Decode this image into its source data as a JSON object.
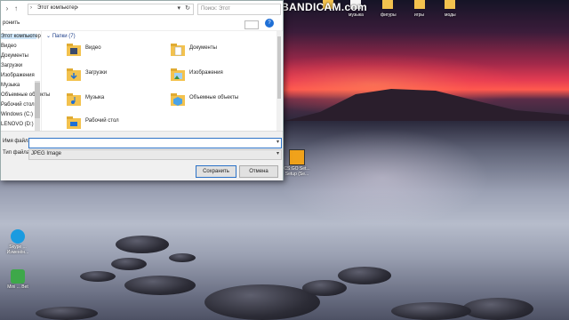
{
  "window": {
    "address_path": "Этот компьютер",
    "search_placeholder": "Поиск: Этот",
    "toolbar_left": "ронить",
    "help_symbol": "?"
  },
  "sidebar": {
    "items": [
      {
        "label": "Этот компьютер"
      },
      {
        "label": "Видео"
      },
      {
        "label": "Документы"
      },
      {
        "label": "Загрузки"
      },
      {
        "label": "Изображения"
      },
      {
        "label": "Музыка"
      },
      {
        "label": "Объемные объекты"
      },
      {
        "label": "Рабочий стол"
      },
      {
        "label": "Windows (C:)"
      },
      {
        "label": "LENOVO (D:)"
      }
    ]
  },
  "content": {
    "group_title": "Папки (7)",
    "folders": [
      {
        "label": "Видео",
        "icon": "video-folder-icon"
      },
      {
        "label": "Документы",
        "icon": "documents-folder-icon"
      },
      {
        "label": "Загрузки",
        "icon": "downloads-folder-icon"
      },
      {
        "label": "Изображения",
        "icon": "pictures-folder-icon"
      },
      {
        "label": "Музыка",
        "icon": "music-folder-icon"
      },
      {
        "label": "Объемные объекты",
        "icon": "3d-objects-folder-icon"
      },
      {
        "label": "Рабочий стол",
        "icon": "desktop-folder-icon"
      }
    ]
  },
  "bottom": {
    "filename_label": "Имя файла:",
    "filename_value": "",
    "filetype_label": "Тип файла:",
    "filetype_value": "JPEG Image",
    "save_label": "Сохранить",
    "cancel_label": "Отмена"
  },
  "watermark": "www.BANDICAM.com",
  "desktop": {
    "top_icons": [
      "музыка",
      "фигуры",
      "игры",
      "моды"
    ],
    "side_icons": [
      {
        "label": "CS:GO Set... Setup (Se..."
      },
      {
        "label": "Skype ... Изменён..."
      },
      {
        "label": "Mini ... Bet"
      }
    ]
  },
  "colors": {
    "accent": "#2c72c7",
    "folder": "#f3c24e",
    "group_title": "#1e3f8a"
  }
}
